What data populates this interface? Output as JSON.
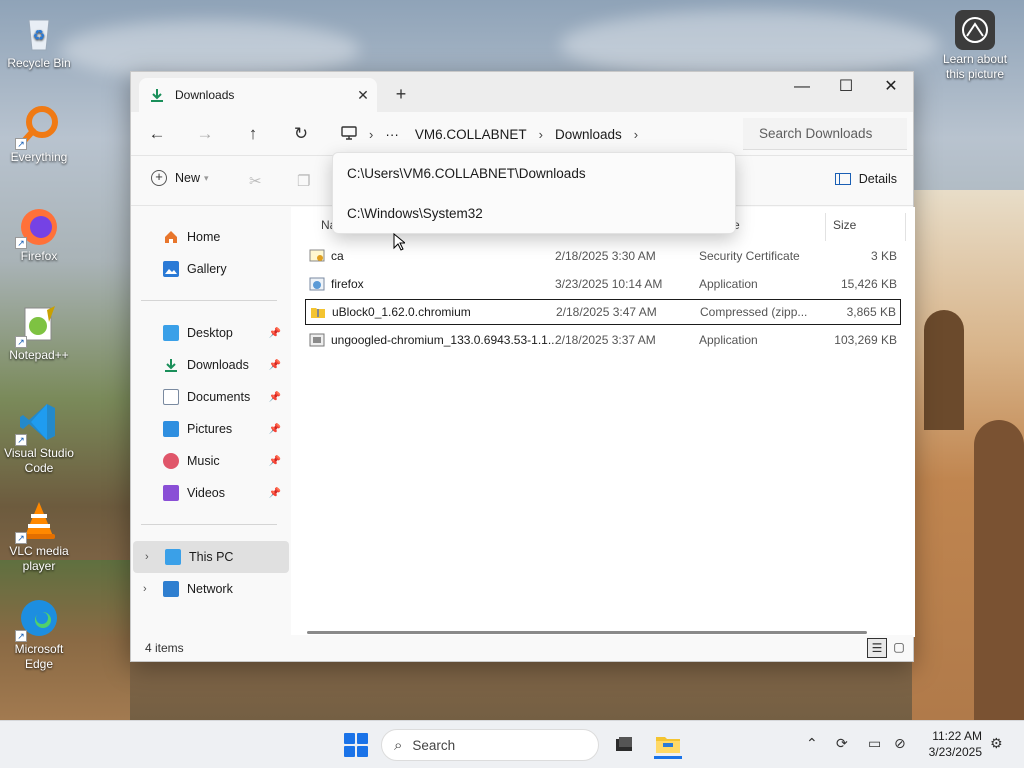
{
  "desktop": {
    "icons": [
      {
        "label": "Recycle Bin"
      },
      {
        "label": "Everything"
      },
      {
        "label": "Firefox"
      },
      {
        "label": "Notepad++"
      },
      {
        "label": "Visual Studio Code"
      },
      {
        "label": "VLC media player"
      },
      {
        "label": "Microsoft Edge"
      }
    ],
    "learn_label": "Learn about this picture"
  },
  "window": {
    "tab_title": "Downloads",
    "new_tab": "+",
    "address": {
      "root_icon": "computer-icon",
      "ellipsis": "···",
      "crumbs": [
        "VM6.COLLABNET",
        "Downloads"
      ]
    },
    "search_placeholder": "Search Downloads",
    "toolbar": {
      "new_label": "New",
      "details_label": "Details"
    },
    "dropdown": {
      "items": [
        "C:\\Users\\VM6.COLLABNET\\Downloads",
        "C:\\Windows\\System32"
      ]
    },
    "sidebar": {
      "top": [
        {
          "label": "Home",
          "icon": "home-icon"
        },
        {
          "label": "Gallery",
          "icon": "gallery-icon"
        }
      ],
      "pinned": [
        {
          "label": "Desktop",
          "icon": "desktop-icon"
        },
        {
          "label": "Downloads",
          "icon": "download-icon"
        },
        {
          "label": "Documents",
          "icon": "documents-icon"
        },
        {
          "label": "Pictures",
          "icon": "pictures-icon"
        },
        {
          "label": "Music",
          "icon": "music-icon"
        },
        {
          "label": "Videos",
          "icon": "videos-icon"
        }
      ],
      "bottom": [
        {
          "label": "This PC",
          "icon": "computer-icon"
        },
        {
          "label": "Network",
          "icon": "network-icon"
        }
      ]
    },
    "columns": {
      "name": "Na",
      "type": "e",
      "size": "Size"
    },
    "files": [
      {
        "name": "ca",
        "date": "2/18/2025 3:30 AM",
        "type": "Security Certificate",
        "size": "3 KB",
        "icon": "certificate-icon"
      },
      {
        "name": "firefox",
        "date": "3/23/2025 10:14 AM",
        "type": "Application",
        "size": "15,426 KB",
        "icon": "application-icon"
      },
      {
        "name": "uBlock0_1.62.0.chromium",
        "date": "2/18/2025 3:47 AM",
        "type": "Compressed (zipp...",
        "size": "3,865 KB",
        "icon": "zip-folder-icon"
      },
      {
        "name": "ungoogled-chromium_133.0.6943.53-1.1...",
        "date": "2/18/2025 3:37 AM",
        "type": "Application",
        "size": "103,269 KB",
        "icon": "installer-icon"
      }
    ],
    "status": "4 items"
  },
  "taskbar": {
    "search_label": "Search",
    "time": "11:22 AM",
    "date": "3/23/2025"
  },
  "colors": {
    "accent": "#1a73e8",
    "folder": "#f4c430",
    "selection_border": "#1b1b1b"
  }
}
